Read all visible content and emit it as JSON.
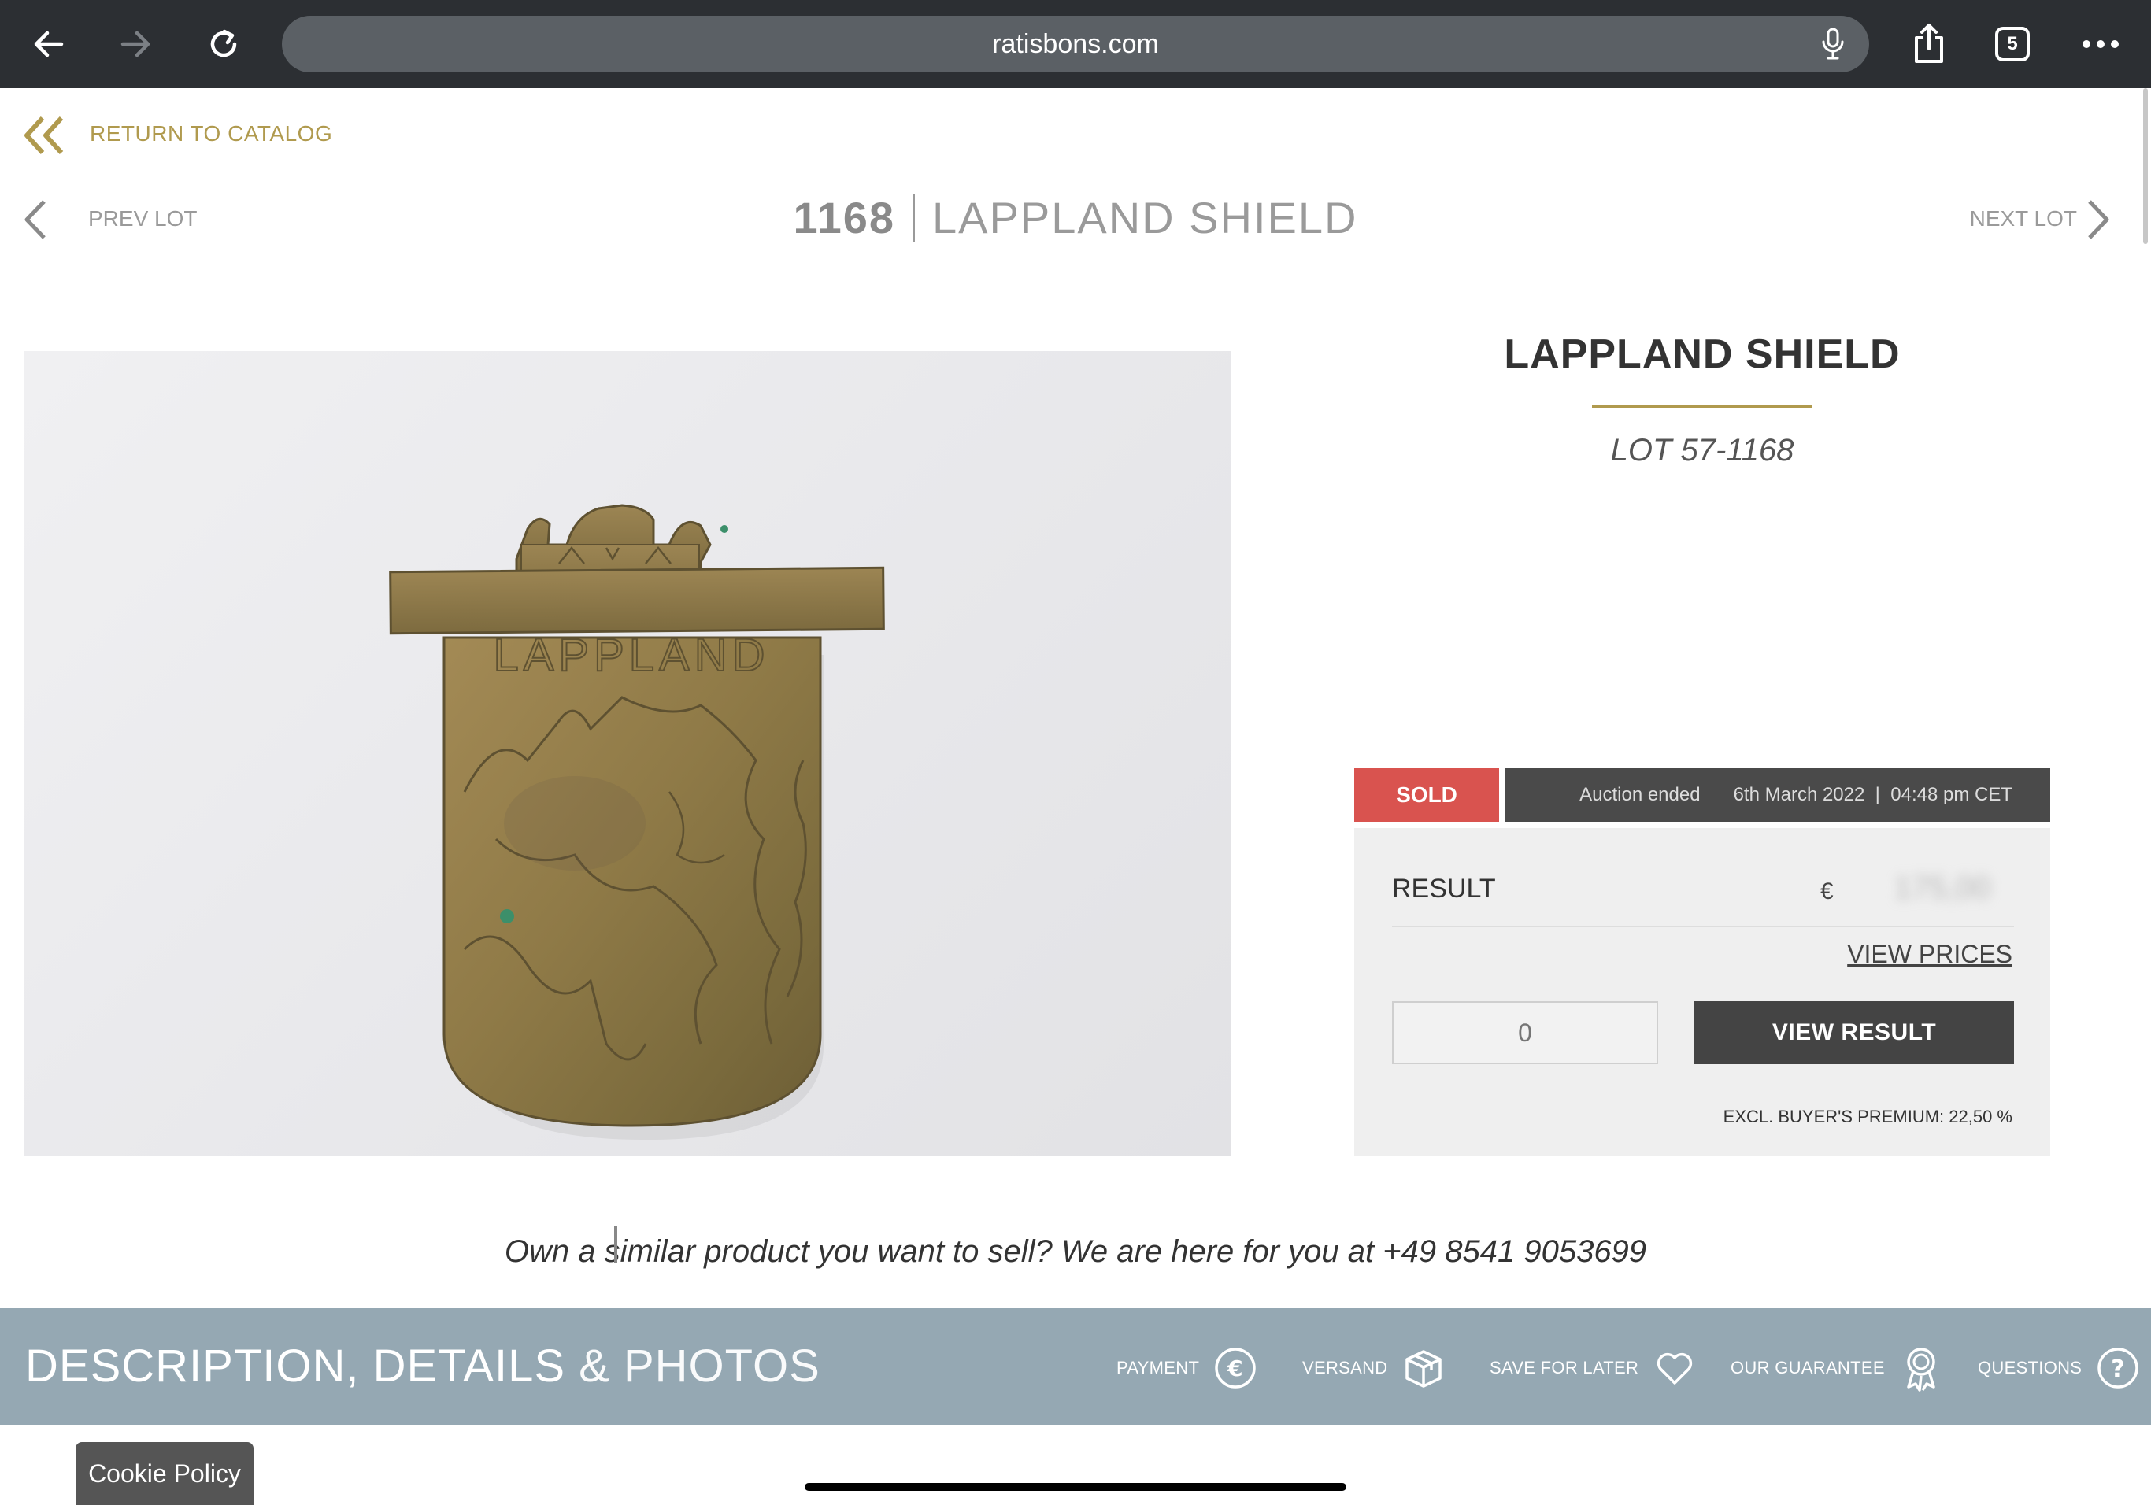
{
  "browser": {
    "url": "ratisbons.com",
    "tab_count": "5"
  },
  "nav": {
    "return_label": "RETURN TO CATALOG",
    "prev_label": "PREV LOT",
    "next_label": "NEXT LOT",
    "lot_number": "1168",
    "lot_title": "LAPPLAND SHIELD"
  },
  "product": {
    "title": "LAPPLAND SHIELD",
    "lot": "LOT 57-1168",
    "image_alt": "LAPPLAND"
  },
  "status": {
    "badge": "SOLD",
    "ended_label": "Auction ended",
    "ended_date": "6th March 2022  |  04:48 pm CET"
  },
  "result": {
    "label": "RESULT",
    "currency": "€",
    "price": "175,00",
    "view_prices": "VIEW PRICES",
    "qty_placeholder": "0",
    "view_result": "VIEW RESULT",
    "premium": "EXCL. BUYER'S PREMIUM: 22,50 %"
  },
  "contact": {
    "text": "Own a similar product you want to sell? We are here for you at ",
    "phone": "+49 8541 9053699"
  },
  "description_bar": {
    "title_bold": "DESCRIPTION, DETAILS",
    "title_light": " & PHOTOS",
    "items": [
      {
        "label": "PAYMENT",
        "icon": "euro-icon"
      },
      {
        "label": "VERSAND",
        "icon": "box-icon"
      },
      {
        "label": "SAVE FOR LATER",
        "icon": "heart-icon"
      },
      {
        "label": "OUR GUARANTEE",
        "icon": "award-icon"
      },
      {
        "label": "QUESTIONS",
        "icon": "question-icon"
      }
    ]
  },
  "cookie": {
    "label": "Cookie Policy"
  },
  "colors": {
    "accent_gold": "#b09a4e",
    "sold_red": "#d9534f",
    "bar_blue": "#95a8b3",
    "dark_button": "#444444"
  }
}
